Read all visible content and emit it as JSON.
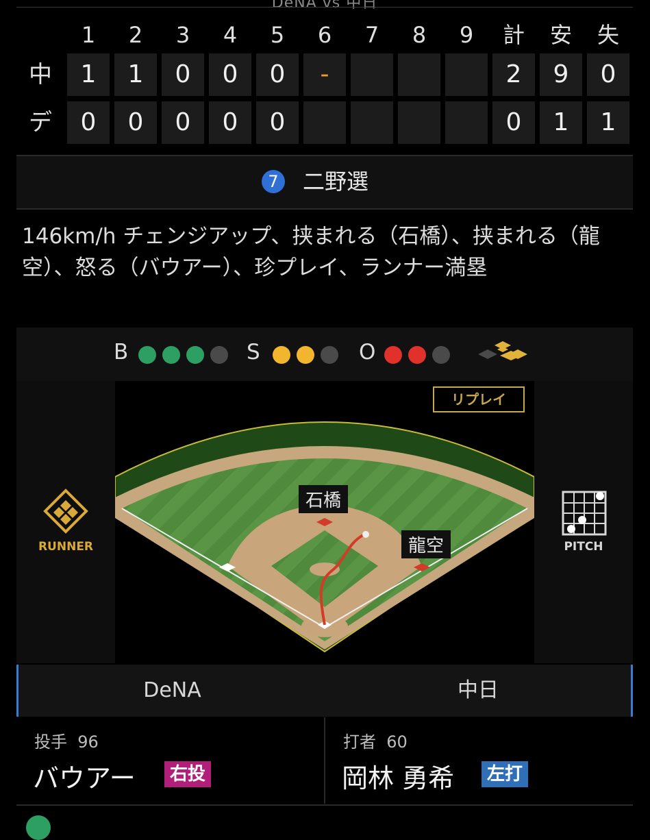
{
  "header": {
    "title": "DeNA vs 中日"
  },
  "scoreboard": {
    "innings": [
      "1",
      "2",
      "3",
      "4",
      "5",
      "6",
      "7",
      "8",
      "9"
    ],
    "totals_headers": [
      "計",
      "安",
      "失"
    ],
    "rows": [
      {
        "team": "中",
        "scores": [
          "1",
          "1",
          "0",
          "0",
          "0",
          "-",
          "",
          "",
          ""
        ],
        "totals": [
          "2",
          "9",
          "0"
        ]
      },
      {
        "team": "デ",
        "scores": [
          "0",
          "0",
          "0",
          "0",
          "0",
          "",
          "",
          "",
          ""
        ],
        "totals": [
          "0",
          "1",
          "1"
        ]
      }
    ]
  },
  "play": {
    "number": "7",
    "result": "二野選"
  },
  "description": "146km/h チェンジアップ、挟まれる（石橋）、挟まれる（龍空）、怒る（バウアー）、珍プレイ、ランナー満塁",
  "count": {
    "balls_label": "B",
    "balls": 3,
    "balls_max": 4,
    "strikes_label": "S",
    "strikes": 2,
    "strikes_max": 3,
    "outs_label": "O",
    "outs": 2,
    "outs_max": 3,
    "colors": {
      "ball": "#2e9f63",
      "strike": "#f2b52e",
      "out": "#e0322b",
      "empty": "#4a4a4a"
    }
  },
  "field": {
    "runner_label": "RUNNER",
    "pitch_label": "PITCH",
    "replay_label": "リプレイ",
    "fielders": [
      "石橋",
      "龍空"
    ]
  },
  "teams": {
    "left": {
      "name": "DeNA",
      "role": "投手",
      "number": "96",
      "player": "バウアー",
      "badge": "右投",
      "badge_color": "#b21f7a"
    },
    "right": {
      "name": "中日",
      "role": "打者",
      "number": "60",
      "player": "岡林 勇希",
      "badge": "左打",
      "badge_color": "#2f6fb8"
    }
  }
}
